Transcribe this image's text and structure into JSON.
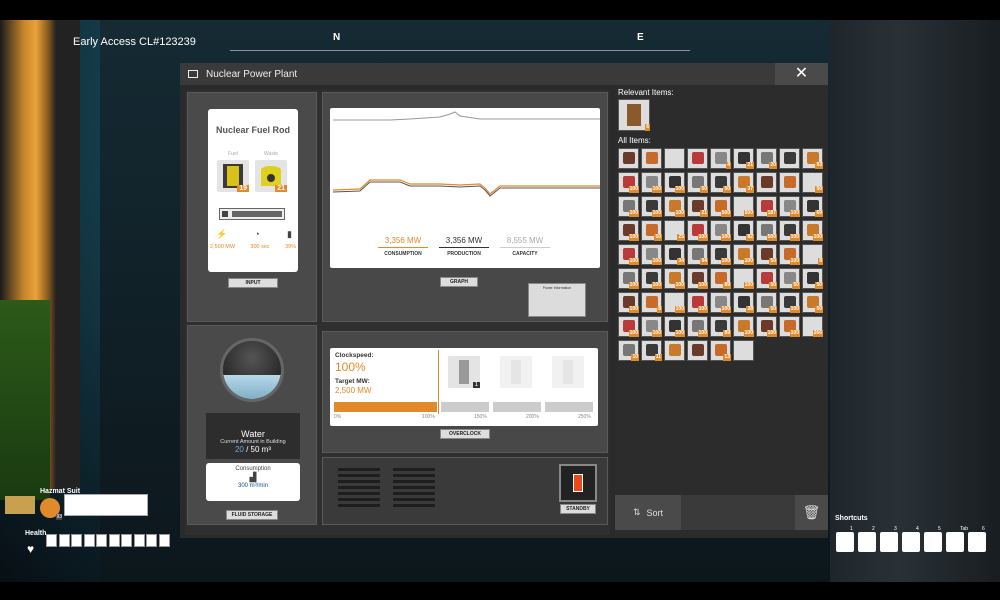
{
  "hud": {
    "build_label": "Early Access CL#123239",
    "compass_n": "N",
    "compass_e": "E"
  },
  "window": {
    "title": "Nuclear Power Plant",
    "close_label": "✕"
  },
  "input": {
    "recipe_title": "Nuclear Fuel Rod",
    "slot_fuel_label": "Fuel",
    "slot_fuel_qty": "19",
    "slot_waste_label": "Waste",
    "slot_waste_qty": "21",
    "stat_power": "2,500 MW",
    "stat_time": "300 sec",
    "stat_eff": "39%",
    "plate_label": "INPUT"
  },
  "graph": {
    "consumption_value": "3,356 MW",
    "consumption_label": "CONSUMPTION",
    "production_value": "3,356 MW",
    "production_label": "PRODUCTION",
    "capacity_value": "8,555 MW",
    "capacity_label": "CAPACITY",
    "plate_label": "GRAPH",
    "info_title": "Power Information"
  },
  "fluid": {
    "name": "Water",
    "amount_label": "Current Amount in Building",
    "amount_current": "20",
    "amount_max": "/ 50 m³",
    "consumption_label": "Consumption",
    "consumption_value": "300 m³/min",
    "plate_label": "FLUID STORAGE"
  },
  "overclock": {
    "clockspeed_label": "Clockspeed:",
    "clockspeed_value": "100%",
    "target_label": "Target MW:",
    "target_value": "2,500 MW",
    "ticks": [
      "0%",
      "100%",
      "150%",
      "200%",
      "250%"
    ],
    "shard_count": "1",
    "plate_label": "OVERCLOCK"
  },
  "standby": {
    "plate_label": "STANDBY"
  },
  "items": {
    "relevant_label": "Relevant Items:",
    "relevant_qty": "6",
    "all_label": "All Items:",
    "grid_qty": [
      [
        "",
        "",
        "",
        "",
        "4",
        "21",
        "20",
        "",
        "93"
      ],
      [
        "100",
        "100",
        "100",
        "50",
        "50",
        "37",
        "",
        "",
        "50"
      ],
      [
        "100",
        "100",
        "100",
        "21",
        "500",
        "500",
        "187",
        "100",
        "69"
      ],
      [
        "100",
        "50",
        "25",
        "100",
        "100",
        "82",
        "500",
        "100",
        "100"
      ],
      [
        "100",
        "100",
        "34",
        "94",
        "100",
        "100",
        "50",
        "100",
        "8"
      ],
      [
        "100",
        "100",
        "100",
        "100",
        "89",
        "100",
        "50",
        "50",
        "50"
      ],
      [
        "100",
        "8",
        "100",
        "100",
        "100",
        "28",
        "50",
        "100",
        "50"
      ],
      [
        "100",
        "100",
        "100",
        "100",
        "89",
        "100",
        "100",
        "100",
        "266"
      ],
      [
        "10",
        "11",
        "",
        "",
        "13",
        "",
        "",
        "",
        ""
      ]
    ],
    "sort_label": "Sort",
    "trash_icon": "trash-icon"
  },
  "player": {
    "equipment_label": "Hazmat Suit",
    "equipment_qty": "93",
    "health_label": "Health",
    "health_cells": 10
  },
  "shortcuts": {
    "label": "Shortcuts",
    "keys": [
      "1",
      "2",
      "3",
      "4",
      "5",
      "Tab",
      "6"
    ]
  },
  "colors": {
    "accent": "#e08a2c",
    "panel": "#3f3f3f",
    "window_bar": "#3a3a3a"
  }
}
